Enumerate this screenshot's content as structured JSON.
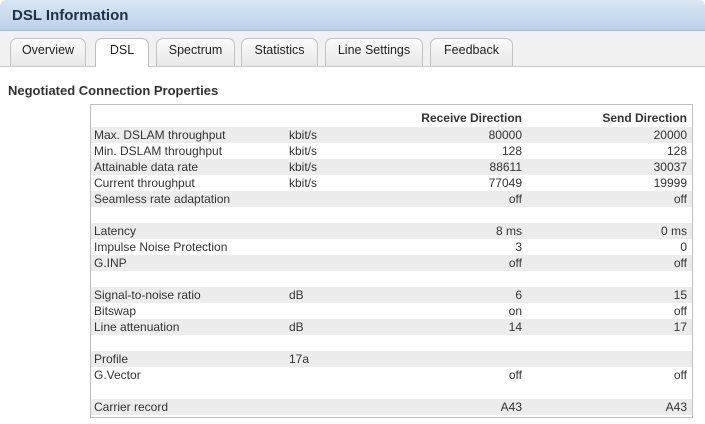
{
  "window": {
    "title": "DSL Information"
  },
  "tabs": [
    {
      "label": "Overview"
    },
    {
      "label": "DSL"
    },
    {
      "label": "Spectrum"
    },
    {
      "label": "Statistics"
    },
    {
      "label": "Line Settings"
    },
    {
      "label": "Feedback"
    }
  ],
  "active_tab": "DSL",
  "section": {
    "title": "Negotiated Connection Properties"
  },
  "table": {
    "headers": {
      "receive": "Receive Direction",
      "send": "Send Direction"
    },
    "rows": [
      {
        "label": "Max. DSLAM throughput",
        "unit": "kbit/s",
        "rx": "80000",
        "tx": "20000"
      },
      {
        "label": "Min. DSLAM throughput",
        "unit": "kbit/s",
        "rx": "128",
        "tx": "128"
      },
      {
        "label": "Attainable data rate",
        "unit": "kbit/s",
        "rx": "88611",
        "tx": "30037"
      },
      {
        "label": "Current throughput",
        "unit": "kbit/s",
        "rx": "77049",
        "tx": "19999"
      },
      {
        "label": "Seamless rate adaptation",
        "unit": "",
        "rx": "off",
        "tx": "off"
      },
      {
        "label": "",
        "unit": "",
        "rx": "",
        "tx": ""
      },
      {
        "label": "Latency",
        "unit": "",
        "rx": "8 ms",
        "tx": "0 ms"
      },
      {
        "label": "Impulse Noise Protection",
        "unit": "",
        "rx": "3",
        "tx": "0"
      },
      {
        "label": "G.INP",
        "unit": "",
        "rx": "off",
        "tx": "off"
      },
      {
        "label": "",
        "unit": "",
        "rx": "",
        "tx": ""
      },
      {
        "label": "Signal-to-noise ratio",
        "unit": "dB",
        "rx": "6",
        "tx": "15"
      },
      {
        "label": "Bitswap",
        "unit": "",
        "rx": "on",
        "tx": "off"
      },
      {
        "label": "Line attenuation",
        "unit": "dB",
        "rx": "14",
        "tx": "17"
      },
      {
        "label": "",
        "unit": "",
        "rx": "",
        "tx": ""
      },
      {
        "label": "Profile",
        "unit": "17a",
        "rx": "",
        "tx": ""
      },
      {
        "label": "G.Vector",
        "unit": "",
        "rx": "off",
        "tx": "off"
      },
      {
        "label": "",
        "unit": "",
        "rx": "",
        "tx": ""
      },
      {
        "label": "Carrier record",
        "unit": "",
        "rx": "A43",
        "tx": "A43"
      }
    ]
  },
  "colors": {
    "titlebar": "#c6d8ec",
    "row_alt": "#ececec"
  }
}
